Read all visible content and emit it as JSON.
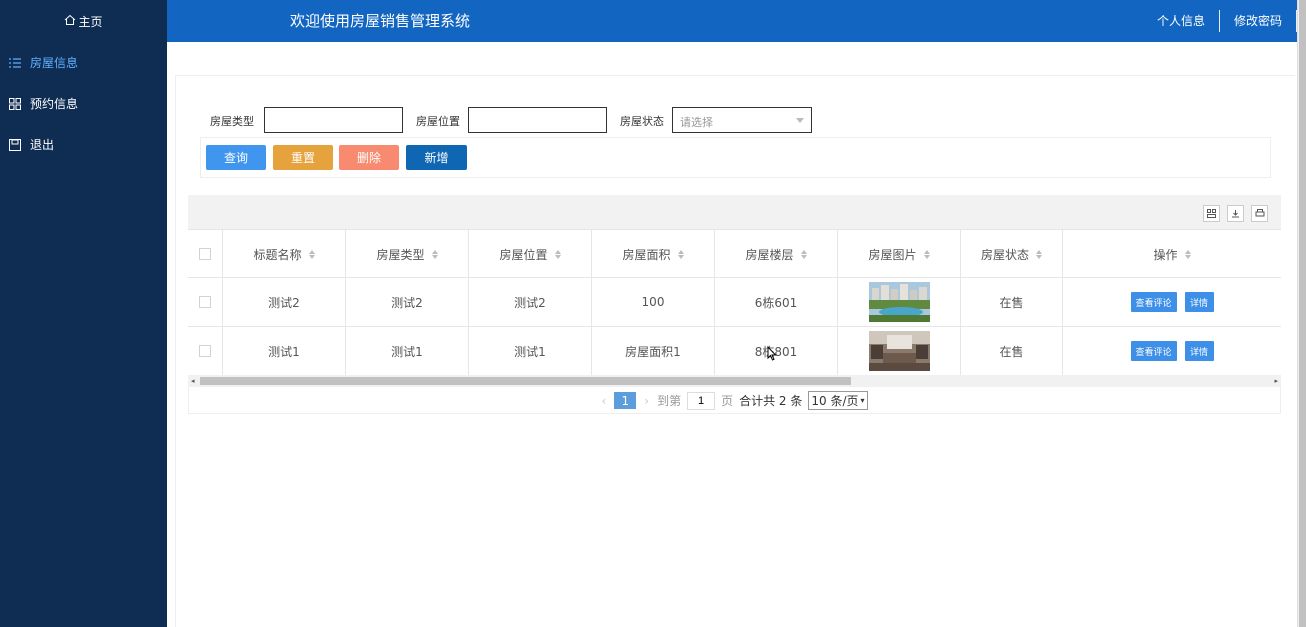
{
  "sidebar": {
    "home_label": "主页",
    "items": [
      {
        "label": "房屋信息",
        "icon": "list-icon"
      },
      {
        "label": "预约信息",
        "icon": "grid-icon"
      },
      {
        "label": "退出",
        "icon": "save-icon"
      }
    ]
  },
  "header": {
    "title": "欢迎使用房屋销售管理系统",
    "profile_label": "个人信息",
    "password_label": "修改密码"
  },
  "filters": {
    "type_label": "房屋类型",
    "location_label": "房屋位置",
    "status_label": "房屋状态",
    "status_placeholder": "请选择"
  },
  "buttons": {
    "query": "查询",
    "reset": "重置",
    "delete": "删除",
    "add": "新增"
  },
  "colors": {
    "sidebar": "#0f2c53",
    "header": "#1266c2",
    "query": "#4096ee",
    "reset": "#e6a23c",
    "delete": "#f78a6f",
    "add": "#0f66b3"
  },
  "table": {
    "headers": [
      "标题名称",
      "房屋类型",
      "房屋位置",
      "房屋面积",
      "房屋楼层",
      "房屋图片",
      "房屋状态",
      "操作"
    ],
    "rows": [
      {
        "title": "测试2",
        "type": "测试2",
        "location": "测试2",
        "area": "100",
        "floor": "6栋601",
        "image": "building-exterior-photo",
        "status": "在售",
        "comment_btn": "查看评论",
        "detail_btn": "详情"
      },
      {
        "title": "测试1",
        "type": "测试1",
        "location": "测试1",
        "area": "房屋面积1",
        "floor": "8栋801",
        "image": "interior-photo",
        "status": "在售",
        "comment_btn": "查看评论",
        "detail_btn": "详情"
      }
    ]
  },
  "pagination": {
    "current_page": "1",
    "goto_label": "到第",
    "goto_value": "1",
    "page_unit": "页",
    "total_text": "合计共 2 条",
    "page_size": "10 条/页"
  }
}
